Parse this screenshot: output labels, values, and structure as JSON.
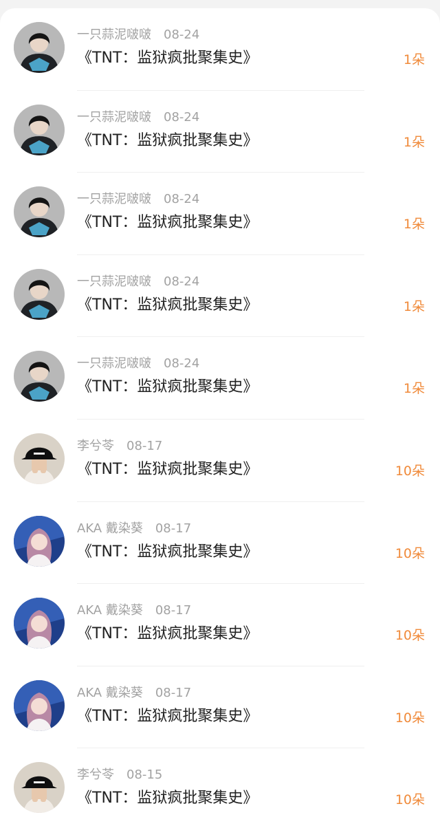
{
  "items": [
    {
      "user": "一只蒜泥啵啵",
      "date": "08-24",
      "title": "《TNT：监狱疯批聚集史》",
      "count": "1朵",
      "avatar": "boy-avatar-icon"
    },
    {
      "user": "一只蒜泥啵啵",
      "date": "08-24",
      "title": "《TNT：监狱疯批聚集史》",
      "count": "1朵",
      "avatar": "boy-avatar-icon"
    },
    {
      "user": "一只蒜泥啵啵",
      "date": "08-24",
      "title": "《TNT：监狱疯批聚集史》",
      "count": "1朵",
      "avatar": "boy-avatar-icon"
    },
    {
      "user": "一只蒜泥啵啵",
      "date": "08-24",
      "title": "《TNT：监狱疯批聚集史》",
      "count": "1朵",
      "avatar": "boy-avatar-icon"
    },
    {
      "user": "一只蒜泥啵啵",
      "date": "08-24",
      "title": "《TNT：监狱疯批聚集史》",
      "count": "1朵",
      "avatar": "boy-avatar-icon"
    },
    {
      "user": "李兮苓",
      "date": "08-17",
      "title": "《TNT：监狱疯批聚集史》",
      "count": "10朵",
      "avatar": "hat-avatar-icon"
    },
    {
      "user": "AKA 戴染葵",
      "date": "08-17",
      "title": "《TNT：监狱疯批聚集史》",
      "count": "10朵",
      "avatar": "girl-avatar-icon"
    },
    {
      "user": "AKA 戴染葵",
      "date": "08-17",
      "title": "《TNT：监狱疯批聚集史》",
      "count": "10朵",
      "avatar": "girl-avatar-icon"
    },
    {
      "user": "AKA 戴染葵",
      "date": "08-17",
      "title": "《TNT：监狱疯批聚集史》",
      "count": "10朵",
      "avatar": "girl-avatar-icon"
    },
    {
      "user": "李兮苓",
      "date": "08-15",
      "title": "《TNT：监狱疯批聚集史》",
      "count": "10朵",
      "avatar": "hat-avatar-icon"
    }
  ],
  "colors": {
    "count": "#f08a3a",
    "user": "#a2a2a2",
    "title": "#222222"
  }
}
